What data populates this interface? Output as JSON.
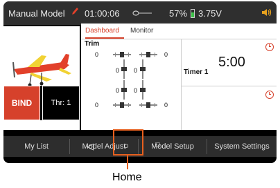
{
  "topbar": {
    "model_name": "Manual Model",
    "timer": "01:00:06",
    "battery_percent": "57%",
    "voltage": "3.75V"
  },
  "tabs": [
    {
      "label": "Dashboard",
      "active": true
    },
    {
      "label": "Monitor",
      "active": false
    }
  ],
  "trim": {
    "title": "Trim",
    "values": [
      "0",
      "0",
      "0",
      "0",
      "0",
      "0",
      "0",
      "0"
    ]
  },
  "timer1": {
    "value": "5:00",
    "label": "Timer 1"
  },
  "bind": {
    "label": "BIND",
    "throttle": "Thr: 1"
  },
  "bottom_nav": {
    "my_list": "My List",
    "model_adjust": "Model Adjust",
    "model_setup": "Model Setup",
    "system_settings": "System Settings"
  },
  "callout": {
    "label": "Home"
  },
  "colors": {
    "accent": "#d6412b",
    "callout": "#e8601e"
  }
}
